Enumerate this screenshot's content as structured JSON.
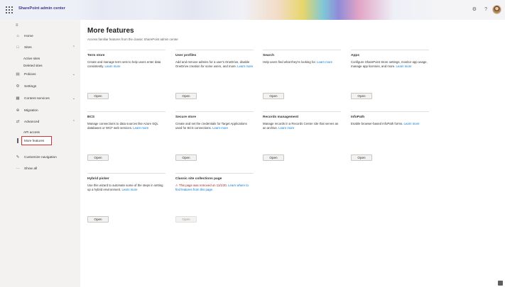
{
  "header": {
    "app_title": "SharePoint admin center",
    "icons": [
      "waffle-icon",
      "gear-icon",
      "help-icon",
      "avatar"
    ],
    "help_glyph": "?"
  },
  "sidebar": {
    "items": [
      {
        "icon": "home-icon",
        "label": "Home",
        "chevron": ""
      },
      {
        "icon": "sites-icon",
        "label": "Sites",
        "chevron": "up"
      },
      {
        "icon": "policies-icon",
        "label": "Policies",
        "chevron": "down"
      },
      {
        "icon": "settings-icon",
        "label": "Settings",
        "chevron": ""
      },
      {
        "icon": "content-services-icon",
        "label": "Content services",
        "chevron": "down"
      },
      {
        "icon": "migration-icon",
        "label": "Migration",
        "chevron": ""
      },
      {
        "icon": "advanced-icon",
        "label": "Advanced",
        "chevron": "up"
      },
      {
        "icon": "customize-icon",
        "label": "Customize navigation",
        "chevron": ""
      },
      {
        "icon": "more-icon",
        "label": "Show all",
        "chevron": ""
      }
    ],
    "sites_sub": [
      "Active sites",
      "Deleted sites"
    ],
    "advanced_sub": [
      "API access",
      "More features"
    ]
  },
  "main": {
    "title": "More features",
    "subtitle": "Access familiar features from the classic SharePoint admin center",
    "cards": [
      {
        "title": "Term store",
        "desc": "Create and manage term sets to help users enter data consistently.",
        "link": "Learn more",
        "button": "Open",
        "disabled": false
      },
      {
        "title": "User profiles",
        "desc": "Add and remove admins for a user's OneDrive, disable OneDrive creation for some users, and more.",
        "link": "Learn more",
        "button": "Open",
        "disabled": false
      },
      {
        "title": "Search",
        "desc": "Help users find what they're looking for.",
        "link": "Learn more",
        "button": "Open",
        "disabled": false
      },
      {
        "title": "Apps",
        "desc": "Configure SharePoint Store settings, monitor app usage, manage app licenses, and more.",
        "link": "Learn more",
        "button": "Open",
        "disabled": false
      },
      {
        "title": "BCS",
        "desc": "Manage connections to data sources like Azure SQL databases or WCF web services.",
        "link": "Learn more",
        "button": "Open",
        "disabled": false
      },
      {
        "title": "Secure store",
        "desc": "Create and set the credentials for Target Applications used for BCS connections.",
        "link": "Learn more",
        "button": "Open",
        "disabled": false
      },
      {
        "title": "Records management",
        "desc": "Manage records in a Records Center site that serves as an archive.",
        "link": "Learn more",
        "button": "Open",
        "disabled": false
      },
      {
        "title": "InfoPath",
        "desc": "Enable browser-based InfoPath forms.",
        "link": "Learn more",
        "button": "Open",
        "disabled": false
      },
      {
        "title": "Hybrid picker",
        "desc": "Use this wizard to automate some of the steps in setting up a hybrid environment.",
        "link": "Learn more",
        "button": "Open",
        "disabled": false
      },
      {
        "title": "Classic site collections page",
        "desc": "⚠ This page was removed on 11/1/20.",
        "link": "Learn where to find features from this page.",
        "button": "Open",
        "disabled": true,
        "warning": true
      }
    ]
  },
  "colors": {
    "accent": "#0078d4",
    "highlight_border": "#d13438",
    "warning_text": "#a4262c",
    "sidebar_bg": "#f3f2f1"
  }
}
